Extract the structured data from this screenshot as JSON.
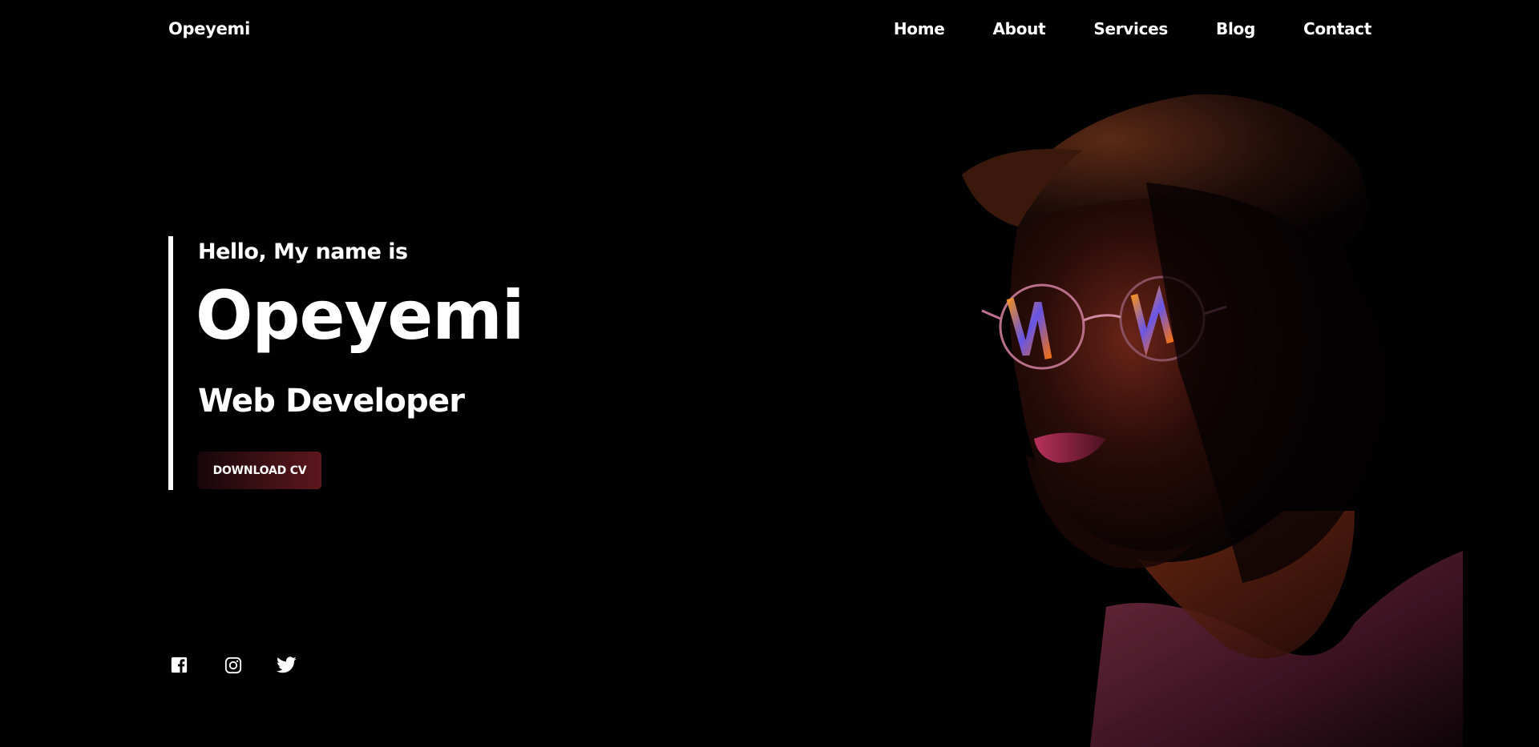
{
  "header": {
    "logo": "Opeyemi",
    "nav": [
      {
        "label": "Home"
      },
      {
        "label": "About"
      },
      {
        "label": "Services"
      },
      {
        "label": "Blog"
      },
      {
        "label": "Contact"
      }
    ]
  },
  "hero": {
    "greeting": "Hello, My name is",
    "name": "Opeyemi",
    "role": "Web Developer",
    "cta_label": "DOWNLOAD CV"
  },
  "social": [
    {
      "icon": "facebook-icon"
    },
    {
      "icon": "instagram-icon"
    },
    {
      "icon": "twitter-icon"
    }
  ],
  "colors": {
    "background": "#000000",
    "text": "#ffffff",
    "button_dark": "#17060a",
    "button_light": "#5c171d"
  }
}
